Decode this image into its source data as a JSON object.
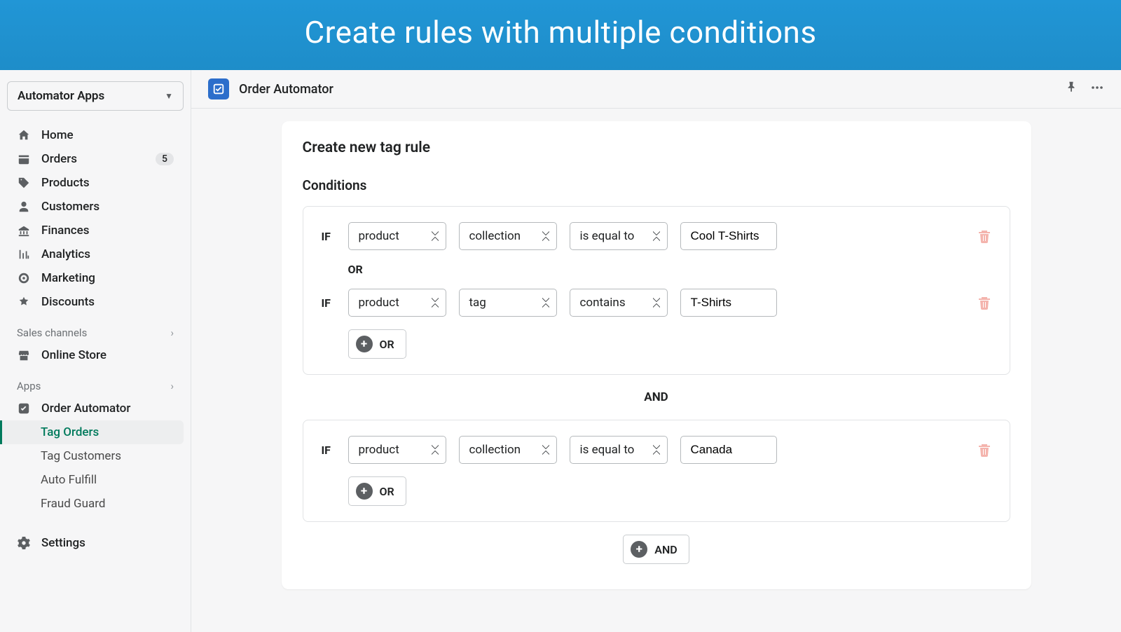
{
  "banner": {
    "title": "Create rules with multiple conditions"
  },
  "sidebar": {
    "store_name": "Automator Apps",
    "nav": [
      {
        "label": "Home"
      },
      {
        "label": "Orders",
        "badge": "5"
      },
      {
        "label": "Products"
      },
      {
        "label": "Customers"
      },
      {
        "label": "Finances"
      },
      {
        "label": "Analytics"
      },
      {
        "label": "Marketing"
      },
      {
        "label": "Discounts"
      }
    ],
    "section_channels": "Sales channels",
    "online_store": "Online Store",
    "section_apps": "Apps",
    "app_item": "Order Automator",
    "app_sub": [
      {
        "label": "Tag Orders"
      },
      {
        "label": "Tag Customers"
      },
      {
        "label": "Auto Fulfill"
      },
      {
        "label": "Fraud Guard"
      }
    ],
    "settings": "Settings"
  },
  "topbar": {
    "app_title": "Order Automator"
  },
  "card": {
    "title": "Create new tag rule",
    "conditions_title": "Conditions",
    "if_label": "IF",
    "or_label": "OR",
    "and_label": "AND",
    "add_or": "OR",
    "add_and": "AND",
    "groups": [
      {
        "rows": [
          {
            "subject": "product",
            "attribute": "collection",
            "operator": "is equal to",
            "value": "Cool T-Shirts"
          },
          {
            "subject": "product",
            "attribute": "tag",
            "operator": "contains",
            "value": "T-Shirts"
          }
        ]
      },
      {
        "rows": [
          {
            "subject": "product",
            "attribute": "collection",
            "operator": "is equal to",
            "value": "Canada"
          }
        ]
      }
    ]
  }
}
